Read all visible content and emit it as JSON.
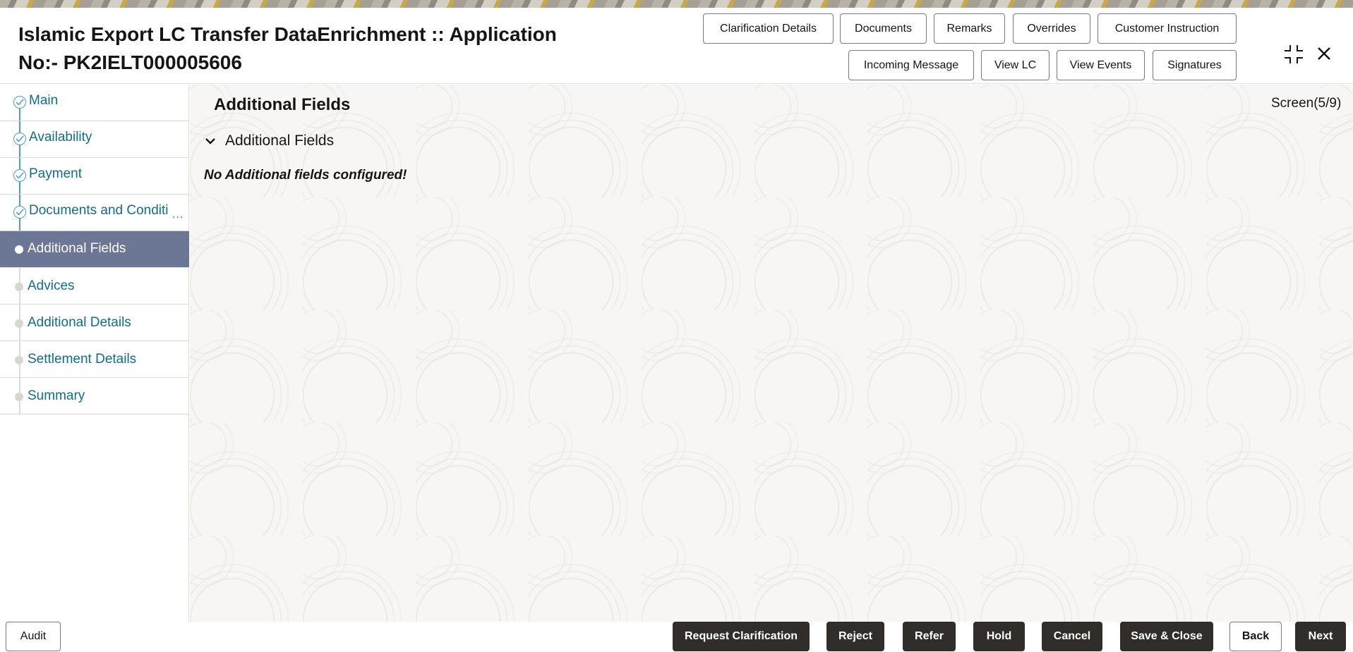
{
  "header": {
    "title_line1": "Islamic Export LC Transfer DataEnrichment :: Application",
    "title_line2": "No:- PK2IELT000005606",
    "buttons_row1": [
      "Clarification Details",
      "Documents",
      "Remarks",
      "Overrides",
      "Customer Instruction"
    ],
    "buttons_row2": [
      "Incoming Message",
      "View LC",
      "View Events",
      "Signatures"
    ]
  },
  "sidebar": {
    "items": [
      {
        "label": "Main",
        "state": "completed"
      },
      {
        "label": "Availability",
        "state": "completed"
      },
      {
        "label": "Payment",
        "state": "completed"
      },
      {
        "label": "Documents and Conditi",
        "state": "completed",
        "truncated": true
      },
      {
        "label": "Additional Fields",
        "state": "active"
      },
      {
        "label": "Advices",
        "state": "pending"
      },
      {
        "label": "Additional Details",
        "state": "pending"
      },
      {
        "label": "Settlement Details",
        "state": "pending"
      },
      {
        "label": "Summary",
        "state": "pending"
      }
    ],
    "more_indicator": "..."
  },
  "main": {
    "section_title": "Additional Fields",
    "screen_counter": "Screen(5/9)",
    "accordion_label": "Additional Fields",
    "empty_message": "No Additional fields configured!"
  },
  "footer": {
    "audit": "Audit",
    "buttons": [
      "Request Clarification",
      "Reject",
      "Refer",
      "Hold",
      "Cancel",
      "Save & Close",
      "Back",
      "Next"
    ]
  },
  "colors": {
    "active_nav": "#6c7695",
    "link": "#0f6e8c",
    "dark_button": "#312d2a",
    "progress_line": "#4aa0c4"
  }
}
